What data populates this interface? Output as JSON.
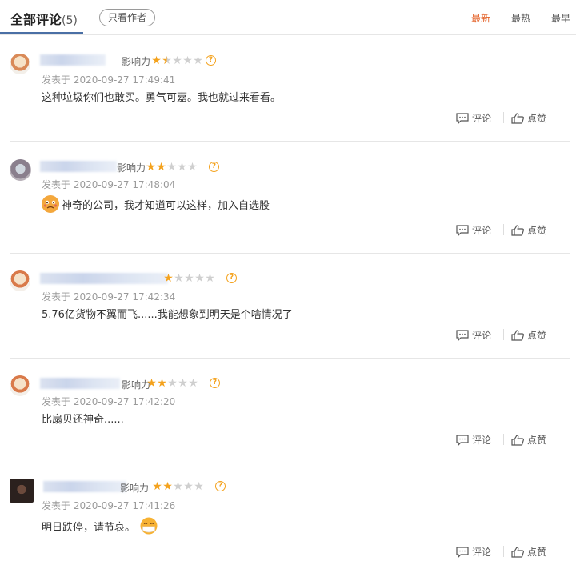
{
  "header": {
    "title": "全部评论",
    "count": "(5)",
    "author_only": "只看作者",
    "sort_newest": "最新",
    "sort_hot": "最热",
    "sort_oldest": "最早"
  },
  "colors": {
    "accent": "#e4632a",
    "star": "#f4a21d",
    "tab_underline": "#4a6fa5"
  },
  "labels": {
    "comment": "评论",
    "like": "点赞"
  },
  "comments": [
    {
      "influence": "影响力",
      "rating": 1.5,
      "time": "发表于 2020-09-27 17:49:41",
      "text": "这种垃圾你们也敢买。勇气可嘉。我也就过来看看。"
    },
    {
      "influence": "影响力",
      "rating": 2,
      "time": "发表于 2020-09-27 17:48:04",
      "text": "神奇的公司，我才知道可以这样，加入自选股",
      "emoji": "crying-face"
    },
    {
      "influence": "",
      "rating": 1,
      "time": "发表于 2020-09-27 17:42:34",
      "text": "5.76亿货物不翼而飞......我能想象到明天是个啥情况了"
    },
    {
      "influence": "影响力",
      "rating": 2,
      "time": "发表于 2020-09-27 17:42:20",
      "text": "比扇贝还神奇......"
    },
    {
      "influence": "影响力",
      "rating": 2,
      "time": "发表于 2020-09-27 17:41:26",
      "text": "明日跌停，请节哀。",
      "emoji": "mask-face"
    }
  ]
}
